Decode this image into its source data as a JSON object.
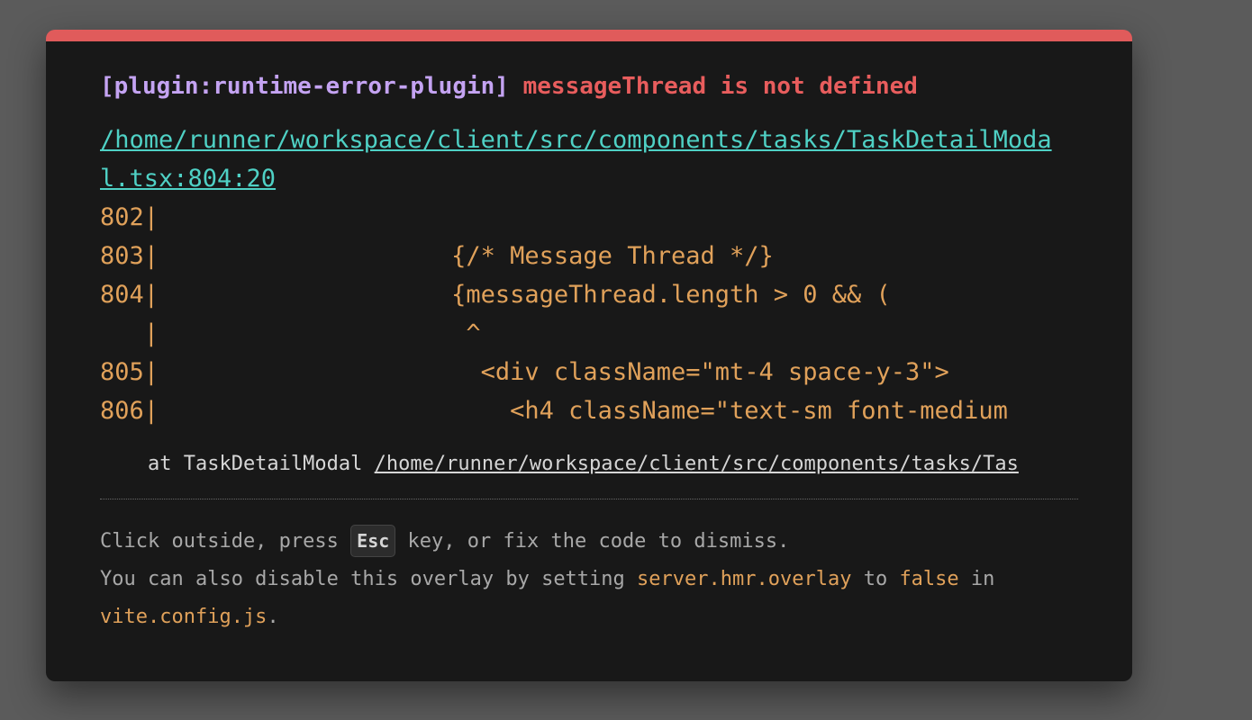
{
  "error": {
    "plugin": "[plugin:runtime-error-plugin]",
    "message": "messageThread is not defined",
    "file": "/home/runner/workspace/client/src/components/tasks/TaskDetailModal.tsx:804:20",
    "frame_lines": [
      "802|",
      "803|                    {/* Message Thread */}",
      "804|                    {messageThread.length > 0 && (",
      "   |                     ^",
      "805|                      <div className=\"mt-4 space-y-3\">",
      "806|                        <h4 className=\"text-sm font-medium"
    ],
    "stack_prefix": "    at TaskDetailModal ",
    "stack_link": "/home/runner/workspace/client/src/components/tasks/Tas"
  },
  "tip": {
    "line1_before": "Click outside, press ",
    "key": "Esc",
    "line1_after": " key, or fix the code to dismiss.",
    "line2_before": "You can also disable this overlay by setting ",
    "line2_code1": "server.hmr.overlay",
    "line2_mid": " to ",
    "line2_code2": "false",
    "line2_after": " in ",
    "line3_code": "vite.config.js",
    "line3_after": "."
  },
  "colors": {
    "accent_bar": "#e05b5b",
    "plugin": "#c4a3f2",
    "message": "#e85d5d",
    "file_link": "#4fd1c5",
    "code": "#e0a15a",
    "panel_bg": "#181818",
    "backdrop": "#5b5b5b"
  }
}
